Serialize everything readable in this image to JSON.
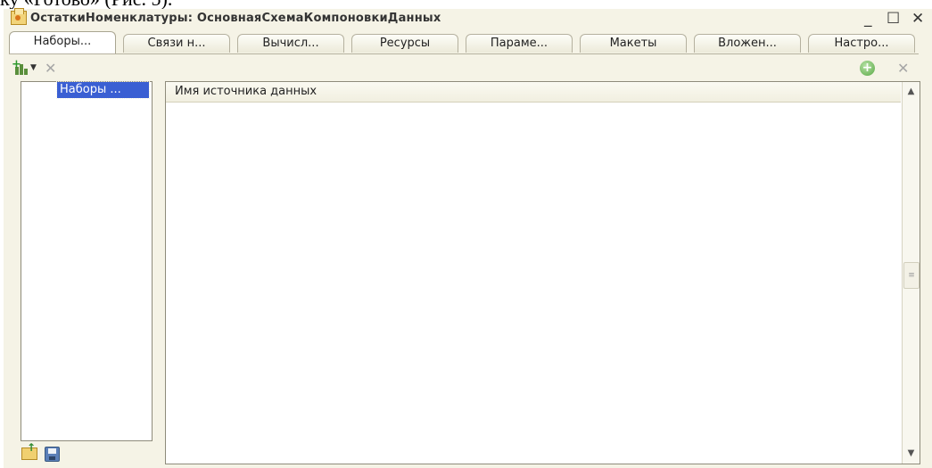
{
  "document_text": "ку «Готово» (Рис. 5).",
  "window": {
    "title": "ОстаткиНоменклатуры: ОсновнаяСхемаКомпоновкиДанных",
    "minimize": "_",
    "maximize": "☐",
    "close": "✕"
  },
  "tabs": [
    {
      "label": "Наборы..."
    },
    {
      "label": "Связи н..."
    },
    {
      "label": "Вычисл..."
    },
    {
      "label": "Ресурсы"
    },
    {
      "label": "Параме..."
    },
    {
      "label": "Макеты"
    },
    {
      "label": "Вложен..."
    },
    {
      "label": "Настро..."
    }
  ],
  "active_tab_index": 0,
  "tree": {
    "items": [
      {
        "label": "Наборы ..."
      }
    ]
  },
  "table": {
    "columns": [
      {
        "label": "Имя источника данных"
      }
    ],
    "rows": []
  },
  "icons": {
    "add_group": "add-dataset-icon",
    "delete": "delete-icon",
    "add": "plus-circle-icon",
    "folder_up": "folder-up-icon",
    "save": "save-icon"
  },
  "colors": {
    "window_bg": "#f5f3e6",
    "selection": "#3a5fd3",
    "border": "#8e8b7b"
  }
}
